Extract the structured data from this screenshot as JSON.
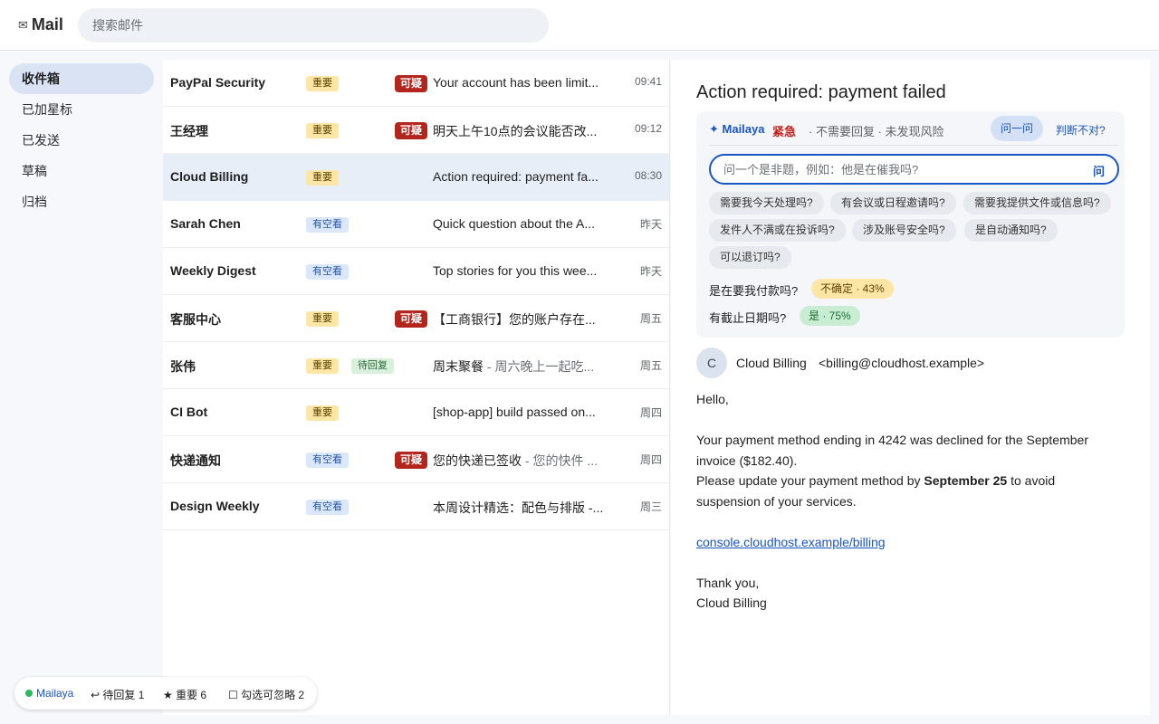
{
  "app": {
    "title": "Mail",
    "logo_icon": "✉"
  },
  "search": {
    "placeholder": "搜索邮件"
  },
  "sidebar": {
    "items": [
      {
        "label": "收件箱",
        "active": true
      },
      {
        "label": "已加星标"
      },
      {
        "label": "已发送"
      },
      {
        "label": "草稿"
      },
      {
        "label": "归档"
      }
    ]
  },
  "badges": {
    "important": "重要",
    "free": "有空看",
    "await_reply": "待回复",
    "suspicious": "可疑"
  },
  "emails": [
    {
      "sender": "PayPal Security",
      "subject": "Your account has been limit...",
      "snippet": "",
      "time": "09:41"
    },
    {
      "sender": "王经理",
      "subject": "明天上午10点的会议能否改...",
      "snippet": "",
      "time": "09:12"
    },
    {
      "sender": "Cloud Billing",
      "subject": "Action required: payment fa...",
      "snippet": "",
      "time": "08:30"
    },
    {
      "sender": "Sarah Chen",
      "subject": "Quick question about the A...",
      "snippet": "",
      "time": "昨天"
    },
    {
      "sender": "Weekly Digest",
      "subject": "Top stories for you this wee...",
      "snippet": "",
      "time": "昨天"
    },
    {
      "sender": "客服中心",
      "subject": "【工商银行】您的账户存在...",
      "snippet": "",
      "time": "周五"
    },
    {
      "sender": "张伟",
      "subject": "周末聚餐",
      "snippet": " - 周六晚上一起吃...",
      "time": "周五"
    },
    {
      "sender": "CI Bot",
      "subject": "[shop-app] build passed on...",
      "snippet": "",
      "time": "周四"
    },
    {
      "sender": "快递通知",
      "subject": "您的快递已签收",
      "snippet": " - 您的快件 ...",
      "time": "周四"
    },
    {
      "sender": "Design Weekly",
      "subject": "本周设计精选：配色与排版 -...",
      "snippet": "",
      "time": "周三"
    }
  ],
  "reader": {
    "title": "Action required: payment failed",
    "assistant": {
      "brand": "✦ Mailaya",
      "urgency": "紧急",
      "meta": "· 不需要回复 · 未发现风险",
      "ask_button": "问一问",
      "wrong_link": "判断不对?",
      "input_placeholder": "问一个是非题，例如：他是在催我吗?",
      "input_submit": "问",
      "chips": [
        "需要我今天处理吗?",
        "有会议或日程邀请吗?",
        "需要我提供文件或信息吗?",
        "发件人不满或在投诉吗?",
        "涉及账号安全吗?",
        "是自动通知吗?",
        "可以退订吗?"
      ],
      "qa": [
        {
          "question": "是在要我付款吗?",
          "answer": "不确定 · 43%"
        },
        {
          "question": "有截止日期吗?",
          "answer": "是 · 75%"
        }
      ]
    },
    "from": {
      "avatar": "C",
      "name": "Cloud Billing",
      "email": "<billing@cloudhost.example>"
    },
    "body": {
      "greeting": "Hello,",
      "line1": "Your payment method ending in 4242 was declined for the September invoice ($182.40).",
      "line2_pre": "Please update your payment method by ",
      "line2_bold": "September 25",
      "line2_post": " to avoid suspension of your services.",
      "link": "console.cloudhost.example/billing",
      "closing": "Thank you,",
      "signature": "Cloud Billing"
    }
  },
  "statusbar": {
    "brand": "Mailaya",
    "awaiting": "↩ 待回复 1",
    "important": "★ 重要 6",
    "ignorable": "☐ 勾选可忽略 2"
  }
}
